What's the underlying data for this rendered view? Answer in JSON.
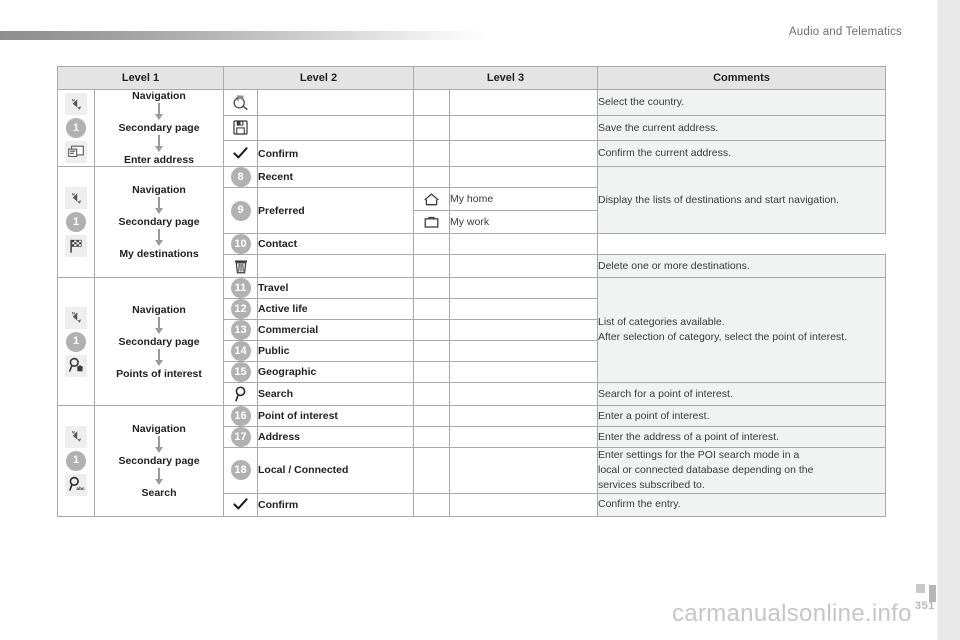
{
  "header": {
    "section_title": "Audio and Telematics"
  },
  "footer": {
    "watermark": "carmanualsonline.info",
    "page_number": "351"
  },
  "table": {
    "headers": [
      "Level 1",
      "Level 2",
      "Level 3",
      "Comments"
    ]
  },
  "rows": [
    {
      "step": "1",
      "flow": [
        "Navigation",
        "Secondary page",
        "Enter address"
      ],
      "items": [
        {
          "icon": "country-search-icon",
          "l2": "",
          "l3": "",
          "comment": "Select the country."
        },
        {
          "icon": "floppy-save-icon",
          "l2": "",
          "l3": "",
          "comment": "Save the current address."
        },
        {
          "icon": "checkmark-icon",
          "l2": "Confirm",
          "l3": "",
          "comment": "Confirm the current address."
        }
      ]
    },
    {
      "step": "1",
      "flow": [
        "Navigation",
        "Secondary page",
        "My destinations"
      ],
      "items": [
        {
          "badge": "8",
          "l2": "Recent",
          "l3": "",
          "comment": "Display the lists of destinations and start navigation."
        },
        {
          "badge": "9",
          "l2": "Preferred",
          "sub": [
            {
              "icon": "house-icon",
              "label": "My home"
            },
            {
              "icon": "briefcase-icon",
              "label": "My work"
            }
          ]
        },
        {
          "badge": "10",
          "l2": "Contact",
          "l3": ""
        },
        {
          "icon": "trash-bin-icon",
          "l2": "",
          "l3": "",
          "comment": "Delete one or more destinations."
        }
      ]
    },
    {
      "step": "1",
      "flow": [
        "Navigation",
        "Secondary page",
        "Points of interest"
      ],
      "items": [
        {
          "badge": "11",
          "l2": "Travel",
          "l3": "",
          "comment_lines": [
            "List of categories available.",
            "After selection of category, select the point of interest."
          ]
        },
        {
          "badge": "12",
          "l2": "Active life",
          "l3": ""
        },
        {
          "badge": "13",
          "l2": "Commercial",
          "l3": ""
        },
        {
          "badge": "14",
          "l2": "Public",
          "l3": ""
        },
        {
          "badge": "15",
          "l2": "Geographic",
          "l3": ""
        },
        {
          "icon": "magnifier-icon",
          "l2": "Search",
          "l3": "",
          "comment": "Search for a point of interest."
        }
      ]
    },
    {
      "step": "1",
      "flow": [
        "Navigation",
        "Secondary page",
        "Search"
      ],
      "items": [
        {
          "badge": "16",
          "l2": "Point of interest",
          "l3": "",
          "comment": "Enter a point of interest."
        },
        {
          "badge": "17",
          "l2": "Address",
          "l3": "",
          "comment": "Enter the address of a point of interest."
        },
        {
          "badge": "18",
          "l2": "Local / Connected",
          "l3": "",
          "comment_lines": [
            "Enter settings for the POI search mode in a",
            "local or connected database depending on the",
            "services subscribed to."
          ]
        },
        {
          "icon": "checkmark-icon",
          "l2": "Confirm",
          "l3": "",
          "comment": "Confirm the entry."
        }
      ]
    }
  ]
}
